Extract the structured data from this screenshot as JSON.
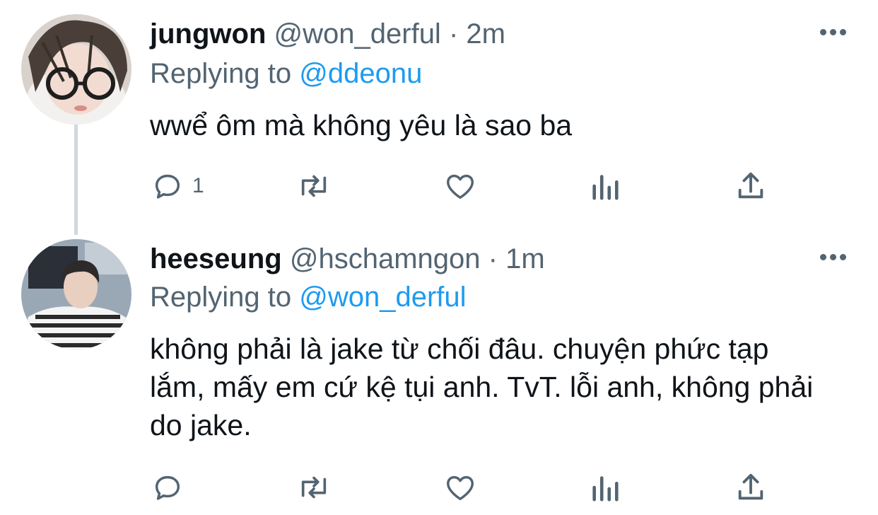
{
  "tweets": [
    {
      "display_name": "jungwon",
      "handle": "@won_derful",
      "separator": "·",
      "time": "2m",
      "replying_prefix": "Replying to",
      "replying_to": "@ddeonu",
      "text": " wwể ôm mà không yêu là sao ba",
      "reply_count": "1",
      "retweet_count": "",
      "like_count": ""
    },
    {
      "display_name": "heeseung",
      "handle": "@hschamngon",
      "separator": "·",
      "time": "1m",
      "replying_prefix": "Replying to",
      "replying_to": "@won_derful",
      "text": "không phải là jake từ chối đâu. chuyện phức tạp lắm, mấy em cứ kệ tụi anh. TvT. lỗi anh, không phải do jake.",
      "reply_count": "",
      "retweet_count": "",
      "like_count": ""
    }
  ],
  "icons": {
    "more": "more-dots-icon",
    "reply": "reply-icon",
    "retweet": "retweet-icon",
    "like": "heart-icon",
    "analytics": "analytics-icon",
    "share": "share-icon"
  },
  "colors": {
    "text_primary": "#0f1419",
    "text_secondary": "#536471",
    "mention": "#1d9bf0",
    "thread_line": "#cfd9de"
  }
}
